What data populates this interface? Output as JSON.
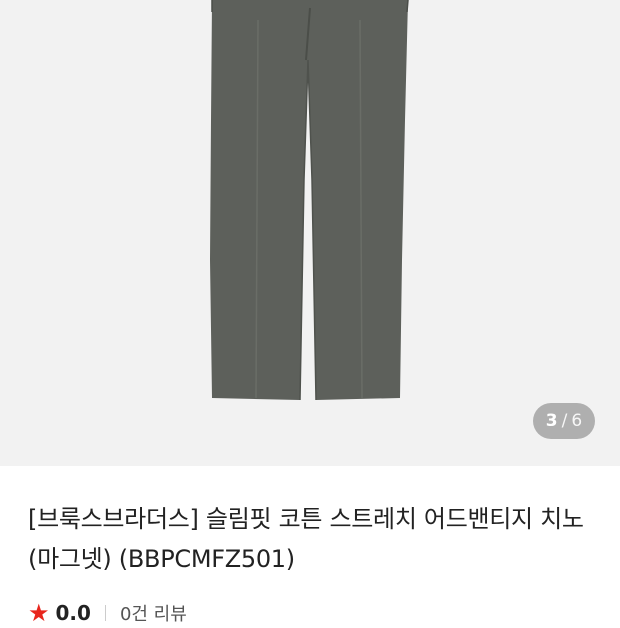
{
  "product": {
    "title": "[브룩스브라더스] 슬림핏 코튼 스트레치 어드밴티지 치노 (마그넷) (BBPCMFZ501)",
    "rating": "0.0",
    "reviews": "0건 리뷰"
  },
  "gallery": {
    "current": "3",
    "separator": "/",
    "total": "6",
    "image": "charcoal-chino-pants"
  },
  "colors": {
    "pants": "#5d605b",
    "gallery_bg": "#f2f2f2",
    "star": "#e8261d"
  }
}
